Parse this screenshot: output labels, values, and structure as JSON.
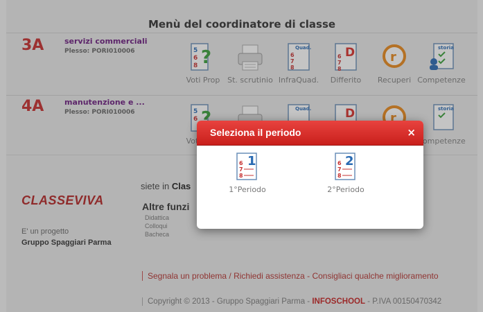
{
  "header": {
    "title": "Menù del coordinatore di classe"
  },
  "classes": [
    {
      "code": "3A",
      "name": "servizi commerciali",
      "plesso": "Plesso: PORI010006"
    },
    {
      "code": "4A",
      "name": "manutenzione e ...",
      "plesso": "Plesso: PORI010006"
    }
  ],
  "actions": {
    "voti_prop": "Voti Prop",
    "st_scrutinio": "St. scrutinio",
    "infraquad": "InfraQuad.",
    "differito": "Differito",
    "recuperi": "Recuperi",
    "competenze": "Competenze"
  },
  "icon_texts": {
    "quad": "Quad.",
    "storia": "storia",
    "n6": "6",
    "n7": "7",
    "n8": "8",
    "n5": "5",
    "d": "D",
    "r": "r",
    "q": "?"
  },
  "footer": {
    "brand": "CLASSEVIVA",
    "siete_prefix": "siete in",
    "siete_bold": "Clas",
    "altre": "Altre funzi",
    "links": [
      "Didattica",
      "Colloqui",
      "Bacheca"
    ],
    "progetto": "E' un progetto",
    "gruppo": "Gruppo Spaggiari Parma",
    "segnala": "Segnala un problema / Richiedi assistenza - Consigliaci qualche miglioramento",
    "copyright_a": "Copyright © 2013 - Gruppo Spaggiari Parma - ",
    "copyright_b": "INFOSCHOOL",
    "copyright_c": " - P.IVA 00150470342"
  },
  "modal": {
    "title": "Seleziona il periodo",
    "close": "×",
    "periods": [
      {
        "num": "1",
        "label": "1°Periodo"
      },
      {
        "num": "2",
        "label": "2°Periodo"
      }
    ]
  },
  "colors": {
    "class_code": "#c62d2d",
    "class_name": "#6a1a7e",
    "modal_header": "#d8302c",
    "link_red": "#b4322f"
  }
}
